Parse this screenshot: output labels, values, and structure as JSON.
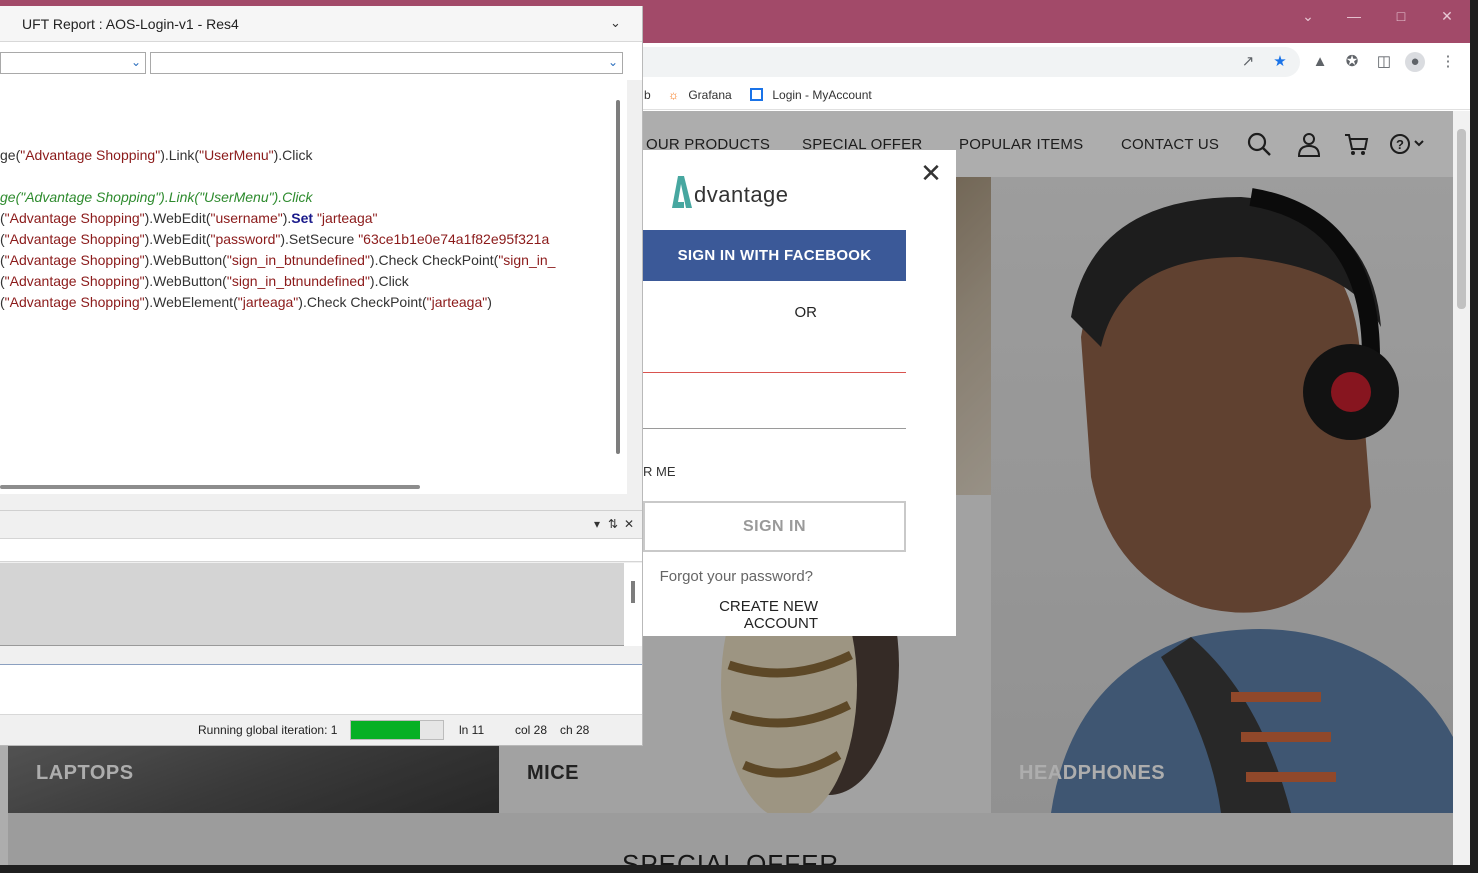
{
  "browser": {
    "bookmarks": [
      {
        "label": "b",
        "icon": "bookmark-icon"
      },
      {
        "label": "Grafana",
        "icon": "grafana-icon"
      },
      {
        "label": "Login - MyAccount",
        "icon": "page-icon"
      }
    ],
    "titlebar_color": "#a24a69"
  },
  "site": {
    "nav": {
      "links": [
        "OUR PRODUCTS",
        "SPECIAL OFFER",
        "POPULAR ITEMS",
        "CONTACT US"
      ]
    },
    "tiles": {
      "laptops": "LAPTOPS",
      "mice": "MICE",
      "headphones": "HEADPHONES"
    },
    "special_offer": "SPECIAL OFFER",
    "login_modal": {
      "logo": "dvantage",
      "facebook_button": "SIGN IN WITH FACEBOOK",
      "or": "OR",
      "remember_me": "R ME",
      "sign_in_button": "SIGN IN",
      "forgot_password": "Forgot your password?",
      "create_account": "CREATE NEW ACCOUNT"
    },
    "accent_color": "#3b5998"
  },
  "uft": {
    "title": "UFT Report : AOS-Login-v1 - Res4",
    "code_lines": [
      {
        "segments": [
          {
            "t": "ge(",
            "c": ""
          },
          {
            "t": "\"Advantage Shopping\"",
            "c": "c-str"
          },
          {
            "t": ").Link(",
            "c": ""
          },
          {
            "t": "\"UserMenu\"",
            "c": "c-str"
          },
          {
            "t": ").Click",
            "c": ""
          }
        ]
      },
      {
        "segments": [
          {
            "t": "ge(\"Advantage Shopping\").Link(\"UserMenu\").Click",
            "c": "c-cmt"
          }
        ]
      },
      {
        "segments": [
          {
            "t": "(",
            "c": ""
          },
          {
            "t": "\"Advantage Shopping\"",
            "c": "c-str"
          },
          {
            "t": ").WebEdit(",
            "c": ""
          },
          {
            "t": "\"username\"",
            "c": "c-str"
          },
          {
            "t": ").",
            "c": ""
          },
          {
            "t": "Set",
            "c": "c-kw"
          },
          {
            "t": " ",
            "c": ""
          },
          {
            "t": "\"jarteaga\"",
            "c": "c-str"
          }
        ]
      },
      {
        "segments": [
          {
            "t": "(",
            "c": ""
          },
          {
            "t": "\"Advantage Shopping\"",
            "c": "c-str"
          },
          {
            "t": ").WebEdit(",
            "c": ""
          },
          {
            "t": "\"password\"",
            "c": "c-str"
          },
          {
            "t": ").SetSecure ",
            "c": ""
          },
          {
            "t": "\"63ce1b1e0e74a1f82e95f321a",
            "c": "c-str"
          }
        ]
      },
      {
        "segments": [
          {
            "t": "(",
            "c": ""
          },
          {
            "t": "\"Advantage Shopping\"",
            "c": "c-str"
          },
          {
            "t": ").WebButton(",
            "c": ""
          },
          {
            "t": "\"sign_in_btnundefined\"",
            "c": "c-str"
          },
          {
            "t": ").Check CheckPoint(",
            "c": ""
          },
          {
            "t": "\"sign_in_",
            "c": "c-str"
          }
        ]
      },
      {
        "segments": [
          {
            "t": "(",
            "c": ""
          },
          {
            "t": "\"Advantage Shopping\"",
            "c": "c-str"
          },
          {
            "t": ").WebButton(",
            "c": ""
          },
          {
            "t": "\"sign_in_btnundefined\"",
            "c": "c-str"
          },
          {
            "t": ").Click",
            "c": ""
          }
        ]
      },
      {
        "segments": [
          {
            "t": "(",
            "c": ""
          },
          {
            "t": "\"Advantage Shopping\"",
            "c": "c-str"
          },
          {
            "t": ").WebElement(",
            "c": ""
          },
          {
            "t": "\"jarteaga\"",
            "c": "c-str"
          },
          {
            "t": ").Check CheckPoint(",
            "c": ""
          },
          {
            "t": "\"jarteaga\"",
            "c": "c-str"
          },
          {
            "t": ")",
            "c": ""
          }
        ]
      }
    ],
    "status": {
      "iteration": "Running global iteration: 1",
      "progress": 0.75,
      "line": "ln 11",
      "col": "col 28",
      "ch": "ch 28"
    }
  }
}
